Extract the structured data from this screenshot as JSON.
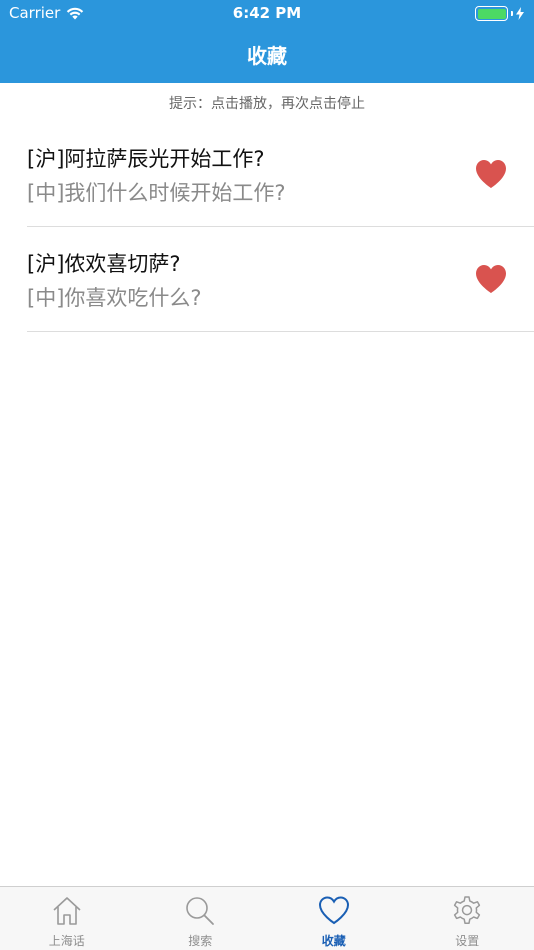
{
  "status_bar": {
    "carrier": "Carrier",
    "time": "6:42 PM"
  },
  "nav": {
    "title": "收藏"
  },
  "hint": "提示：点击播放，再次点击停止",
  "favorites": [
    {
      "shanghainese": "[沪]阿拉萨辰光开始工作?",
      "mandarin": "[中]我们什么时候开始工作?"
    },
    {
      "shanghainese": "[沪]侬欢喜切萨?",
      "mandarin": "[中]你喜欢吃什么?"
    }
  ],
  "tabs": [
    {
      "label": "上海话",
      "icon": "home-icon"
    },
    {
      "label": "搜索",
      "icon": "search-icon"
    },
    {
      "label": "收藏",
      "icon": "heart-icon",
      "active": true
    },
    {
      "label": "设置",
      "icon": "gear-icon"
    }
  ],
  "colors": {
    "nav": "#2b96dc",
    "heart": "#d9534f",
    "tab_active": "#1a5fb4"
  }
}
